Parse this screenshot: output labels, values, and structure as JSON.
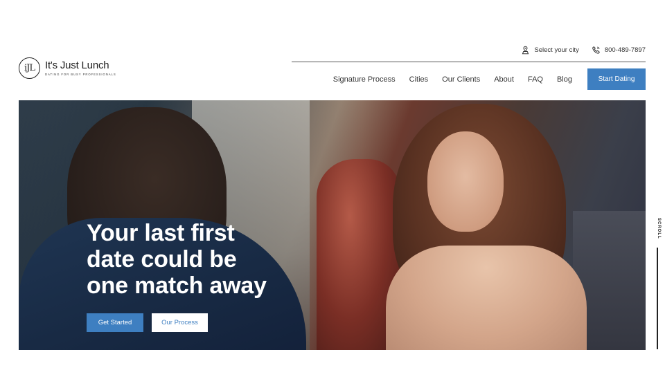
{
  "header": {
    "logo_mark": "iJL",
    "logo_name": "It's Just Lunch",
    "logo_tagline": "DATING FOR BUSY PROFESSIONALS",
    "select_city": "Select your city",
    "phone": "800-489-7897",
    "nav": [
      "Signature Process",
      "Cities",
      "Our Clients",
      "About",
      "FAQ",
      "Blog"
    ],
    "cta_label": "Start Dating"
  },
  "hero": {
    "headline": [
      "Your last first",
      "date could be",
      "one match away"
    ],
    "primary_button": "Get Started",
    "secondary_button": "Our Process",
    "scroll_label": "SCROLL"
  },
  "colors": {
    "accent": "#3e7fc1",
    "text": "#222222",
    "background": "#ffffff"
  },
  "icons": {
    "city": "location-pin-icon",
    "phone": "phone-icon"
  }
}
